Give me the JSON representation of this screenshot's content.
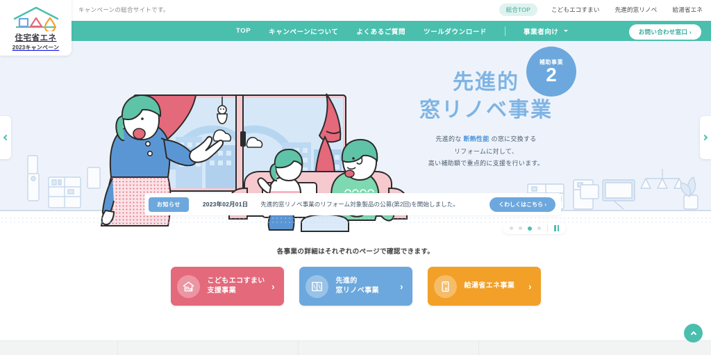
{
  "brand": {
    "logo_line1": "住宅省エネ",
    "logo_line2": "2023キャンペーン",
    "logo_icon": "house-logo-icon"
  },
  "utility": {
    "tagline": "キャンペーンの総合サイトです。",
    "links": [
      {
        "label": "総合TOP",
        "active": true
      },
      {
        "label": "こどもエコすまい",
        "active": false
      },
      {
        "label": "先進的窓リノベ",
        "active": false
      },
      {
        "label": "給湯省エネ",
        "active": false
      }
    ]
  },
  "mainnav": {
    "items": [
      {
        "label": "TOP"
      },
      {
        "label": "キャンペーンについて"
      },
      {
        "label": "よくあるご質問"
      },
      {
        "label": "ツールダウンロード"
      },
      {
        "label": "事業者向け",
        "has_caret": true
      }
    ],
    "contact_label": "お問い合わせ窓口 ›"
  },
  "hero": {
    "title": "先進的\n窓リノベ事業",
    "desc_before": "先進的な ",
    "desc_highlight": "断熱性能",
    "desc_after": " の窓に交換する",
    "desc_line2": "リフォームに対して、",
    "desc_line3": "高い補助額で重点的に支援を行います。",
    "badge_label": "補助事業",
    "badge_number": "2",
    "prev_label": "前のスライド",
    "next_label": "次のスライド",
    "accent_color": "#7fb4e4"
  },
  "news": {
    "tag": "お知らせ",
    "date": "2023年02月01日",
    "text": "先進的窓リノベ事業のリフォーム対象製品の公募(第2回)を開始しました。",
    "more_label": "くわしくはこちら ›"
  },
  "carousel": {
    "dots": [
      {
        "active": false
      },
      {
        "active": false
      },
      {
        "active": true
      },
      {
        "active": false
      }
    ],
    "pause_label": "一時停止"
  },
  "cards_section": {
    "lead": "各事業の詳細はそれぞれのページで確認できます。",
    "cards": [
      {
        "label": "こどもエコすまい\n支援事業",
        "color": "#e4697b",
        "theme": "pink",
        "icon": "house-icon",
        "arrow": "›"
      },
      {
        "label": "先進的\n窓リノベ事業",
        "color": "#6ca8dd",
        "theme": "blue",
        "icon": "window-icon",
        "arrow": "›"
      },
      {
        "label": "給湯省エネ事業",
        "color": "#f2a027",
        "theme": "orange",
        "icon": "water-heater-icon",
        "arrow": "›"
      }
    ]
  },
  "footer": {
    "to_top_label": "ページ上部へ戻る"
  }
}
